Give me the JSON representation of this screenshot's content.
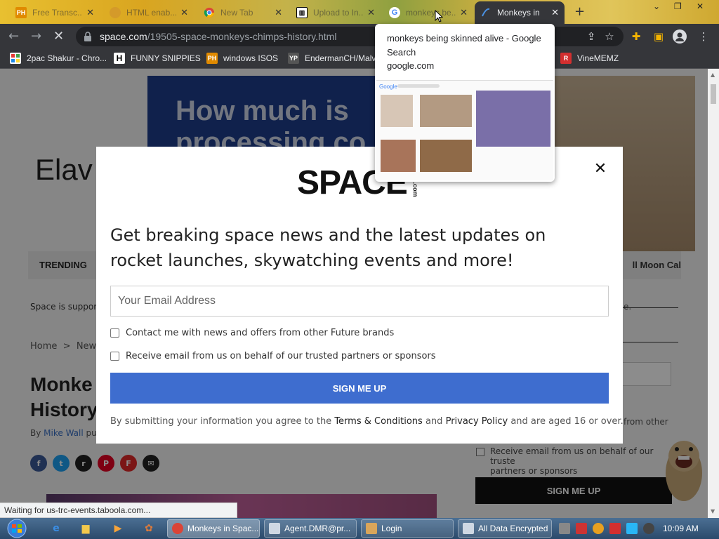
{
  "browser": {
    "tabs": [
      {
        "label": "Free Transc...",
        "icon": "ph-icon"
      },
      {
        "label": "HTML enab...",
        "icon": "coin-icon"
      },
      {
        "label": "New Tab",
        "icon": "chrome-icon"
      },
      {
        "label": "Upload to In...",
        "icon": "archive-icon"
      },
      {
        "label": "monkeys be...",
        "icon": "google-icon"
      },
      {
        "label": "Monkeys in",
        "icon": "space-icon"
      }
    ],
    "url_domain": "space.com",
    "url_path": "/19505-space-monkeys-chimps-history.html",
    "bookmarks": [
      {
        "label": "2pac Shakur - Chro...",
        "icon": "gallery-icon"
      },
      {
        "label": "FUNNY SNIPPIES",
        "icon": "h-icon"
      },
      {
        "label": "windows ISOS",
        "icon": "ph-icon"
      },
      {
        "label": "EndermanCH/Malv",
        "icon": "yp-icon"
      },
      {
        "label": "VineMEMZ",
        "icon": "r-icon"
      }
    ]
  },
  "hover_card": {
    "title": "monkeys being skinned alive - Google Search",
    "domain": "google.com",
    "thumb_google": "Google"
  },
  "page": {
    "banner_headline": "How much is",
    "banner_headline2": "processing co",
    "logo_partial": "Elav",
    "trending_label": "TRENDING",
    "trending_right": "ll Moon Cal",
    "support_text": "Space is suppor",
    "breadcrumb_home": "Home",
    "breadcrumb_sep": ">",
    "breadcrumb_news": "News",
    "title_line1": "Monke",
    "title_line2": "History",
    "byline_author": "Mike Wall",
    "byline_prefix": "By",
    "byline_suffix": "pu",
    "social_icons": [
      "f",
      "t",
      "r",
      "P",
      "F",
      "✉"
    ],
    "side_text_1": "e.",
    "side_text_2": "from other",
    "side_text_3": "Receive email from us on behalf of our truste",
    "side_text_4": "partners or sponsors",
    "side_button": "SIGN ME UP"
  },
  "modal": {
    "brand": "SPACE",
    "brand_suffix": ".com",
    "heading": "Get breaking space news and the latest updates on rocket launches, skywatching events and more!",
    "email_placeholder": "Your Email Address",
    "checkbox_1": "Contact me with news and offers from other Future brands",
    "checkbox_2": "Receive email from us on behalf of our trusted partners or sponsors",
    "submit": "SIGN ME UP",
    "legal_prefix": "By submitting your information you agree to the",
    "legal_terms": "Terms & Conditions",
    "legal_and": "and",
    "legal_privacy": "Privacy Policy",
    "legal_suffix": "and are aged 16 or over.",
    "close": "✕"
  },
  "status": "Waiting for us-trc-events.taboola.com...",
  "taskbar": {
    "tasks": [
      {
        "label": "Monkeys in Spac...",
        "icon": "chrome-icon"
      },
      {
        "label": "Agent.DMR@pr...",
        "icon": "window-icon"
      },
      {
        "label": "Login",
        "icon": "user-icon"
      },
      {
        "label": "All Data Encrypted",
        "icon": "window-icon"
      }
    ],
    "clock": "10:09 AM"
  },
  "colors": {
    "modal_button": "#3e6dcf",
    "chrome_dark": "#35363a",
    "taskbar": "#2b4a6b"
  }
}
